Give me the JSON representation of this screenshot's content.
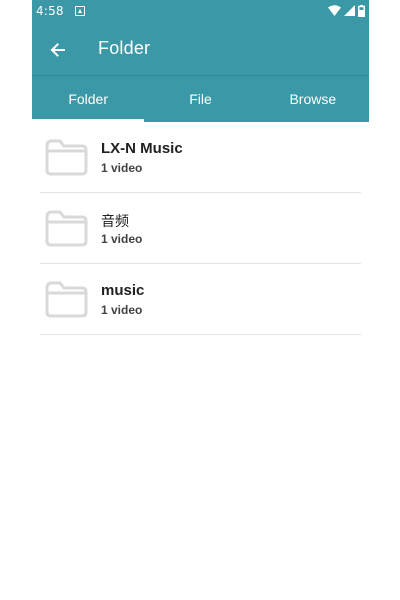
{
  "status_bar": {
    "time": "4:58"
  },
  "app_bar": {
    "title": "Folder",
    "back_icon": "arrow-left-icon"
  },
  "tabs": [
    {
      "label": "Folder",
      "active": true
    },
    {
      "label": "File",
      "active": false
    },
    {
      "label": "Browse",
      "active": false
    }
  ],
  "folders": [
    {
      "name": "LX-N Music",
      "count": "1 video"
    },
    {
      "name": "音频",
      "count": "1 video"
    },
    {
      "name": "music",
      "count": "1 video"
    }
  ],
  "colors": {
    "primary": "#3b98a7",
    "folder_icon": "#d9d9d9",
    "divider": "#e3e3e3"
  }
}
